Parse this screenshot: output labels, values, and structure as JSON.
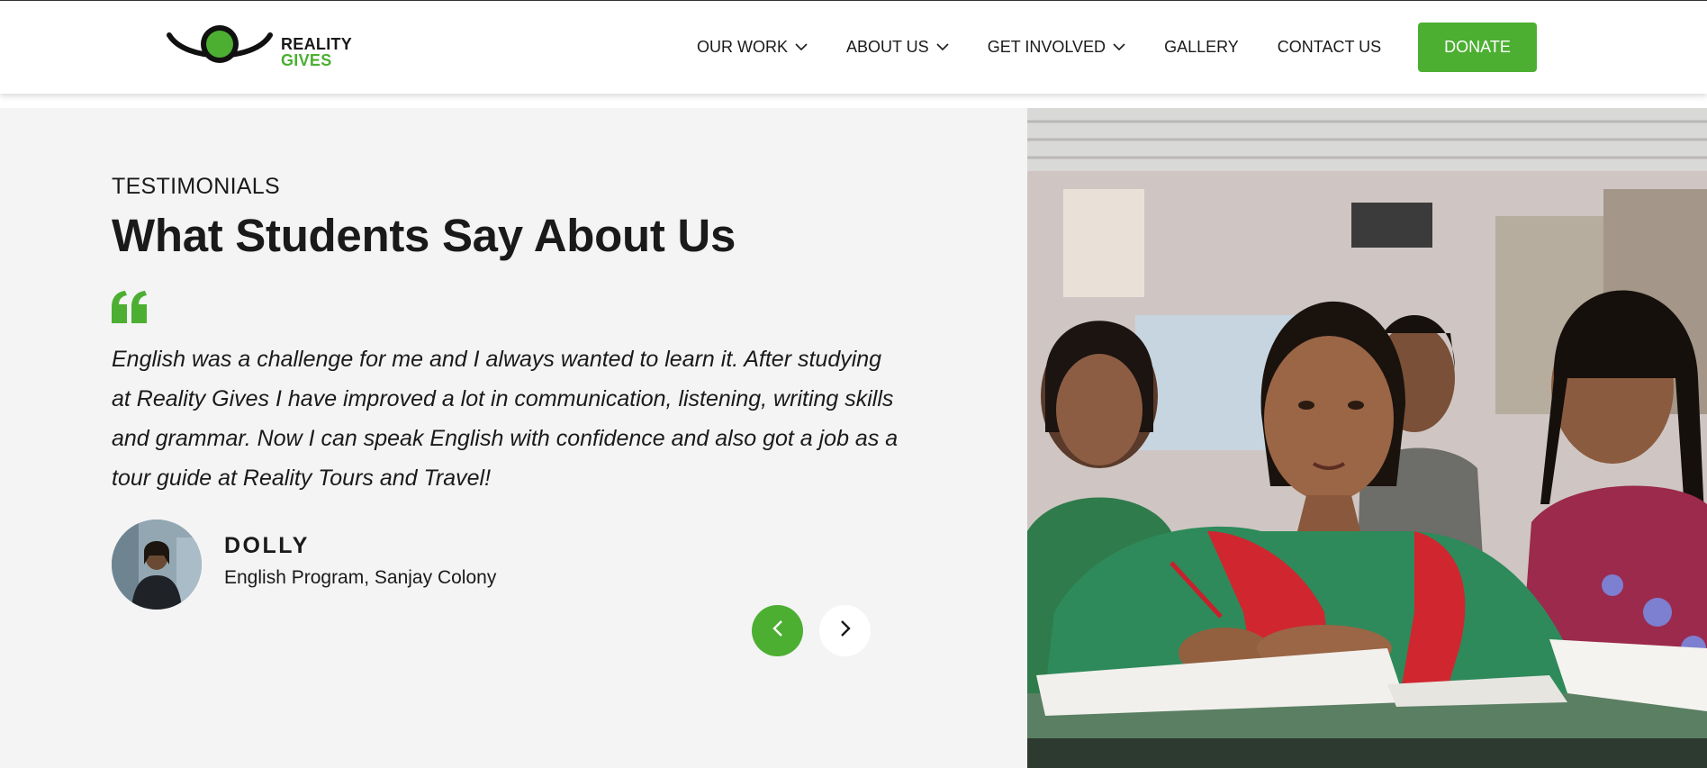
{
  "brand": {
    "line1": "REALITY",
    "line2": "GIVES",
    "green": "#4caf32",
    "dark": "#1a1a1a"
  },
  "nav": {
    "items": [
      {
        "label": "OUR WORK",
        "has_dropdown": true
      },
      {
        "label": "ABOUT US",
        "has_dropdown": true
      },
      {
        "label": "GET INVOLVED",
        "has_dropdown": true
      },
      {
        "label": "GALLERY",
        "has_dropdown": false
      },
      {
        "label": "CONTACT US",
        "has_dropdown": false
      }
    ],
    "donate_label": "DONATE"
  },
  "testimonial": {
    "eyebrow": "TESTIMONIALS",
    "heading": "What Students Say About Us",
    "quote": "English was a challenge for me and I always wanted to learn it. After studying at Reality Gives I have improved a lot in communication, listening, writing skills and grammar. Now I can speak English with confidence and also got a job as a tour guide at Reality Tours and Travel!",
    "author_name": "DOLLY",
    "author_role": "English Program, Sanjay Colony"
  },
  "icons": {
    "quote": "quote-icon",
    "prev": "chevron-left-icon",
    "next": "chevron-right-icon",
    "dropdown": "chevron-down-icon"
  }
}
